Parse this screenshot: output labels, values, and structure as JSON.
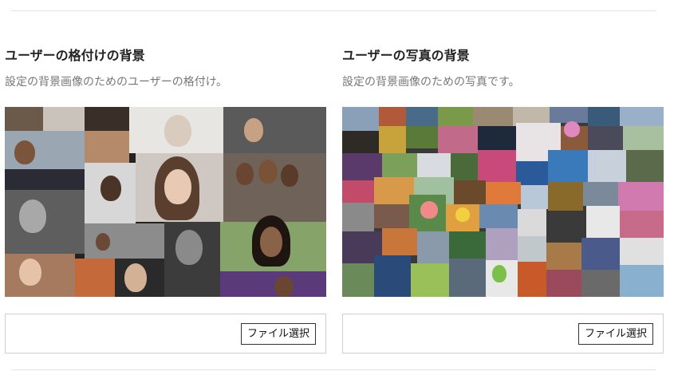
{
  "panels": [
    {
      "title": "ユーザーの格付けの背景",
      "description": "設定の背景画像のためのユーザーの格付け。",
      "collage_icon": "people-portraits-collage",
      "file_button_label": "ファイル選択"
    },
    {
      "title": "ユーザーの写真の背景",
      "description": "設定の背景画像のための写真です。",
      "collage_icon": "photo-thumbnails-collage",
      "file_button_label": "ファイル選択"
    }
  ]
}
